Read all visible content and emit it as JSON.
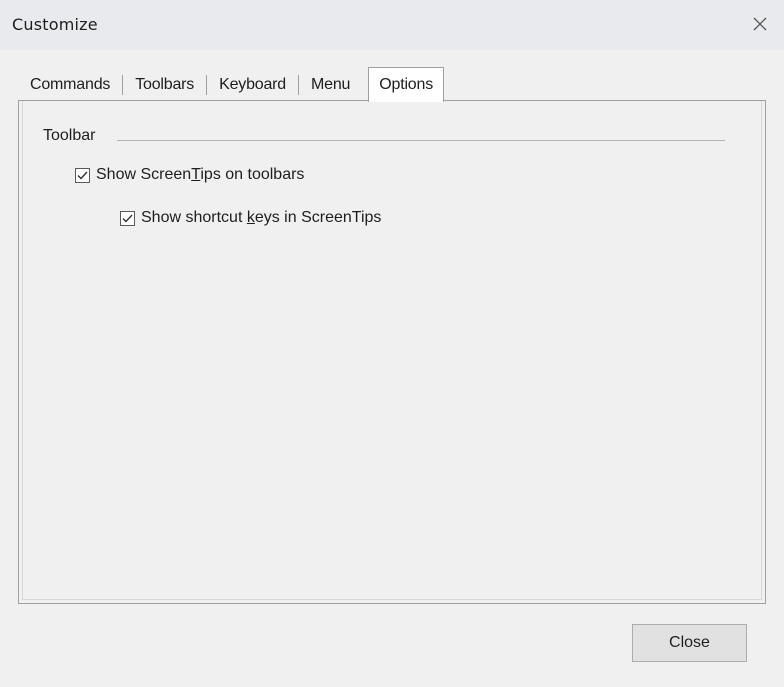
{
  "window": {
    "title": "Customize",
    "close_glyph": "✕"
  },
  "tabs": [
    {
      "label": "Commands",
      "active": false
    },
    {
      "label": "Toolbars",
      "active": false
    },
    {
      "label": "Keyboard",
      "active": false
    },
    {
      "label": "Menu",
      "active": false
    },
    {
      "label": "Options",
      "active": true
    }
  ],
  "options": {
    "group_title": "Toolbar",
    "show_screentips": {
      "label_before": "Show Screen",
      "label_mnemonic": "T",
      "label_after": "ips on toolbars",
      "checked": true
    },
    "show_shortcut_keys": {
      "label_before": "Show shortcut ",
      "label_mnemonic": "k",
      "label_after": "eys in ScreenTips",
      "checked": true
    }
  },
  "footer": {
    "close_label": "Close"
  },
  "icons": {
    "close": "close-icon",
    "checkmark": "checkmark-icon"
  },
  "colors": {
    "titlebar_bg": "#e9eaee",
    "window_bg": "#f0f0f0",
    "tab_active_bg": "#ffffff",
    "border": "#a0a0a0"
  }
}
